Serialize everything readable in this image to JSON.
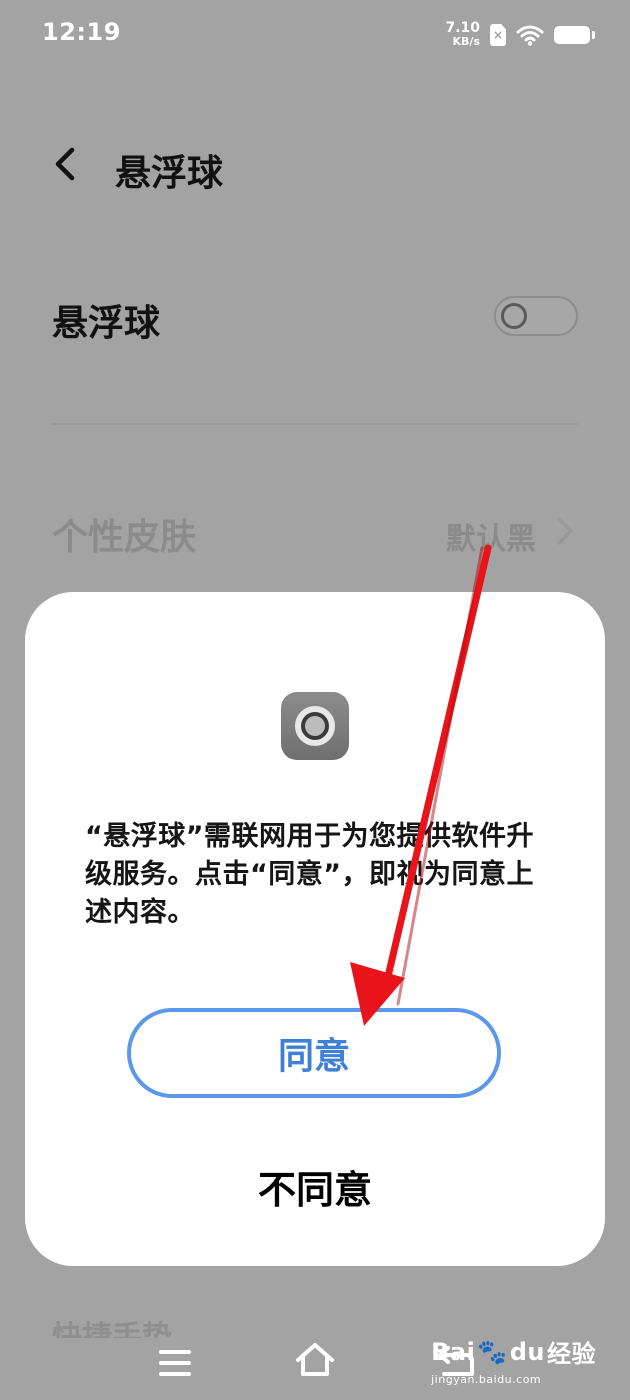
{
  "status_bar": {
    "time": "12:19",
    "net_speed_value": "7.10",
    "net_speed_unit": "KB/s",
    "sim_label": "×"
  },
  "header": {
    "title": "悬浮球"
  },
  "settings": {
    "float_ball_label": "悬浮球",
    "float_ball_enabled": false,
    "skin_label": "个性皮肤",
    "skin_value": "默认黑",
    "partial_row_label": "快捷手势"
  },
  "dialog": {
    "message": "“悬浮球”需联网用于为您提供软件升级服务。点击“同意”，即视为同意上述内容。",
    "agree_label": "同意",
    "disagree_label": "不同意"
  },
  "watermark": {
    "logo_text_a": "Bai",
    "logo_text_b": "du",
    "logo_text_c": "经验",
    "url": "jingyan.baidu.com"
  },
  "colors": {
    "accent_blue": "#5b97ea",
    "arrow_red": "#e8141a",
    "overlay_gray": "#a3a3a3"
  }
}
